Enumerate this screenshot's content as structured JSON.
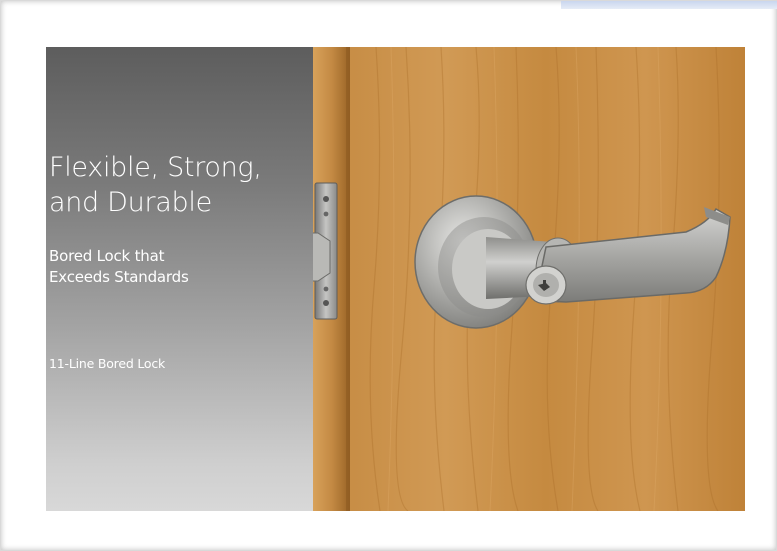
{
  "headline": {
    "line1": "Flexible, Strong,",
    "line2": "and Durable"
  },
  "subheadline": {
    "line1": "Bored Lock that",
    "line2": "Exceeds Standards"
  },
  "product_name": "11-Line Bored Lock",
  "colors": {
    "panel_top": "#5d5d5d",
    "panel_bottom": "#d8d8d8",
    "wood": "#c98f43",
    "wood_dark": "#a86c27",
    "steel": "#a9a9a7"
  },
  "icons": {
    "lock": "lever-lockset-illustration",
    "latch": "door-latch-illustration"
  }
}
